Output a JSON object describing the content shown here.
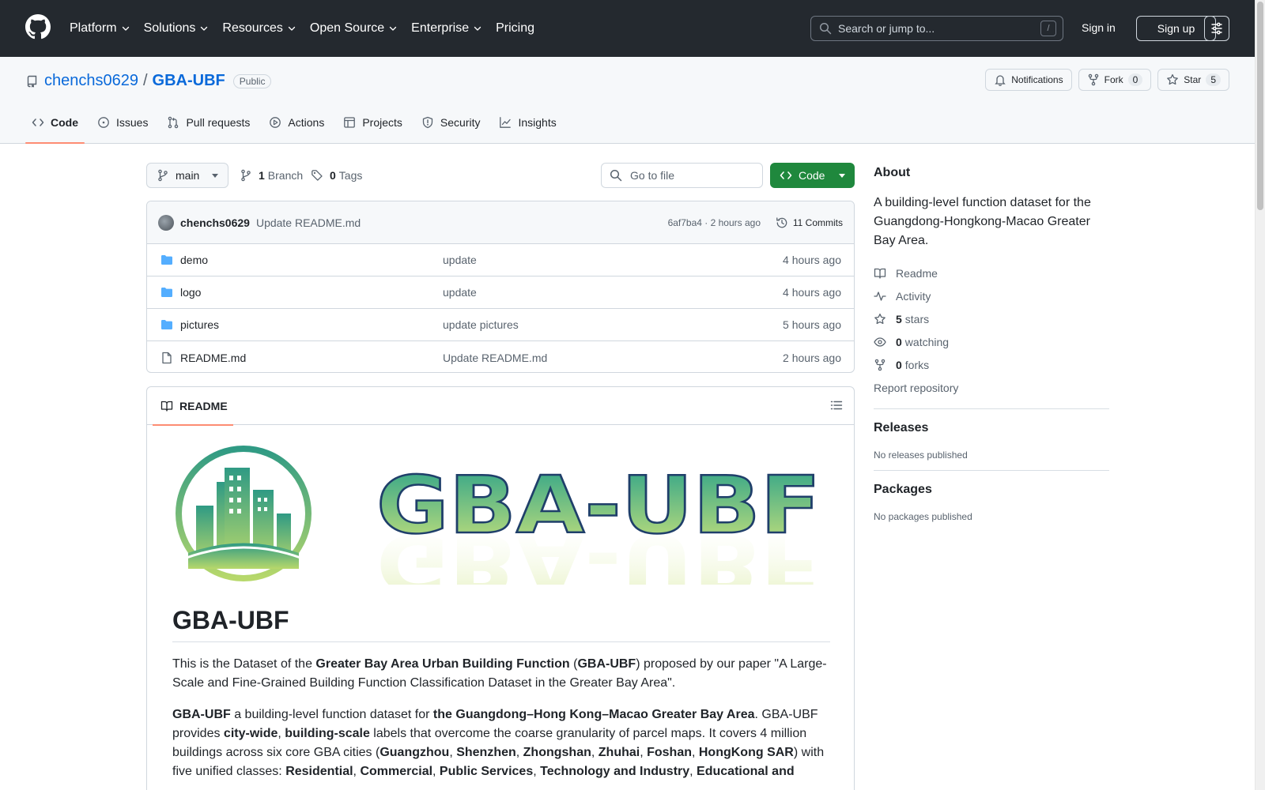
{
  "header": {
    "nav": [
      {
        "label": "Platform",
        "has_caret": true
      },
      {
        "label": "Solutions",
        "has_caret": true
      },
      {
        "label": "Resources",
        "has_caret": true
      },
      {
        "label": "Open Source",
        "has_caret": true
      },
      {
        "label": "Enterprise",
        "has_caret": true
      },
      {
        "label": "Pricing",
        "has_caret": false
      }
    ],
    "search_placeholder": "Search or jump to...",
    "search_shortcut": "/",
    "signin": "Sign in",
    "signup": "Sign up"
  },
  "repo": {
    "owner": "chenchs0629",
    "separator": "/",
    "name": "GBA-UBF",
    "visibility": "Public",
    "actions": {
      "notifications": "Notifications",
      "fork_label": "Fork",
      "fork_count": "0",
      "star_label": "Star",
      "star_count": "5"
    },
    "tabs": [
      {
        "label": "Code",
        "icon": "code-icon",
        "active": true
      },
      {
        "label": "Issues",
        "icon": "issue-icon",
        "active": false
      },
      {
        "label": "Pull requests",
        "icon": "pull-request-icon",
        "active": false
      },
      {
        "label": "Actions",
        "icon": "play-icon",
        "active": false
      },
      {
        "label": "Projects",
        "icon": "table-icon",
        "active": false
      },
      {
        "label": "Security",
        "icon": "shield-icon",
        "active": false
      },
      {
        "label": "Insights",
        "icon": "graph-icon",
        "active": false
      }
    ]
  },
  "filenav": {
    "branch": "main",
    "branches_count": "1",
    "branches_label": "Branch",
    "tags_count": "0",
    "tags_label": "Tags",
    "goto_placeholder": "Go to file",
    "code_button": "Code"
  },
  "commit": {
    "author": "chenchs0629",
    "message": "Update README.md",
    "meta": "6af7ba4 · 2 hours ago",
    "commits_label": "11 Commits"
  },
  "files": [
    {
      "type": "dir",
      "name": "demo",
      "message": "update",
      "time": "4 hours ago"
    },
    {
      "type": "dir",
      "name": "logo",
      "message": "update",
      "time": "4 hours ago"
    },
    {
      "type": "dir",
      "name": "pictures",
      "message": "update pictures",
      "time": "5 hours ago"
    },
    {
      "type": "file",
      "name": "README.md",
      "message": "Update README.md",
      "time": "2 hours ago"
    }
  ],
  "readme": {
    "tab_label": "README",
    "wordmark": "GBA-UBF",
    "heading": "GBA-UBF",
    "p1": [
      {
        "t": "This is the Dataset of the ",
        "b": false
      },
      {
        "t": "Greater Bay Area Urban Building Function",
        "b": true
      },
      {
        "t": " (",
        "b": false
      },
      {
        "t": "GBA-UBF",
        "b": true
      },
      {
        "t": ") proposed by our paper \"A Large-Scale and Fine-Grained Building Function Classification Dataset in the Greater Bay Area\".",
        "b": false
      }
    ],
    "p2": [
      {
        "t": "GBA-UBF",
        "b": true
      },
      {
        "t": " a building-level function dataset for ",
        "b": false
      },
      {
        "t": "the Guangdong–Hong Kong–Macao Greater Bay Area",
        "b": true
      },
      {
        "t": ". GBA-UBF provides ",
        "b": false
      },
      {
        "t": "city-wide",
        "b": true
      },
      {
        "t": ", ",
        "b": false
      },
      {
        "t": "building-scale",
        "b": true
      },
      {
        "t": " labels that overcome the coarse granularity of parcel maps. It covers 4 million buildings across six core GBA cities (",
        "b": false
      },
      {
        "t": "Guangzhou",
        "b": true
      },
      {
        "t": ", ",
        "b": false
      },
      {
        "t": "Shenzhen",
        "b": true
      },
      {
        "t": ", ",
        "b": false
      },
      {
        "t": "Zhongshan",
        "b": true
      },
      {
        "t": ", ",
        "b": false
      },
      {
        "t": "Zhuhai",
        "b": true
      },
      {
        "t": ", ",
        "b": false
      },
      {
        "t": "Foshan",
        "b": true
      },
      {
        "t": ", ",
        "b": false
      },
      {
        "t": "HongKong SAR",
        "b": true
      },
      {
        "t": ") with five unified classes: ",
        "b": false
      },
      {
        "t": "Residential",
        "b": true
      },
      {
        "t": ", ",
        "b": false
      },
      {
        "t": "Commercial",
        "b": true
      },
      {
        "t": ", ",
        "b": false
      },
      {
        "t": "Public Services",
        "b": true
      },
      {
        "t": ", ",
        "b": false
      },
      {
        "t": "Technology and Industry",
        "b": true
      },
      {
        "t": ", ",
        "b": false
      },
      {
        "t": "Educational and",
        "b": true
      }
    ]
  },
  "sidebar": {
    "about_title": "About",
    "description": "A building-level function dataset for the Guangdong-Hongkong-Macao Greater Bay Area.",
    "items": [
      {
        "icon": "book-icon",
        "count": "",
        "label": "Readme"
      },
      {
        "icon": "pulse-icon",
        "count": "",
        "label": "Activity"
      },
      {
        "icon": "star-icon",
        "count": "5",
        "label": "stars"
      },
      {
        "icon": "eye-icon",
        "count": "0",
        "label": "watching"
      },
      {
        "icon": "fork-icon",
        "count": "0",
        "label": "forks"
      }
    ],
    "report": "Report repository",
    "releases_title": "Releases",
    "releases_empty": "No releases published",
    "packages_title": "Packages",
    "packages_empty": "No packages published"
  },
  "colors": {
    "header_bg": "#24292f",
    "link": "#0969da",
    "primary_button": "#1f883d",
    "tab_underline": "#fd8c73",
    "folder": "#54aeff"
  }
}
